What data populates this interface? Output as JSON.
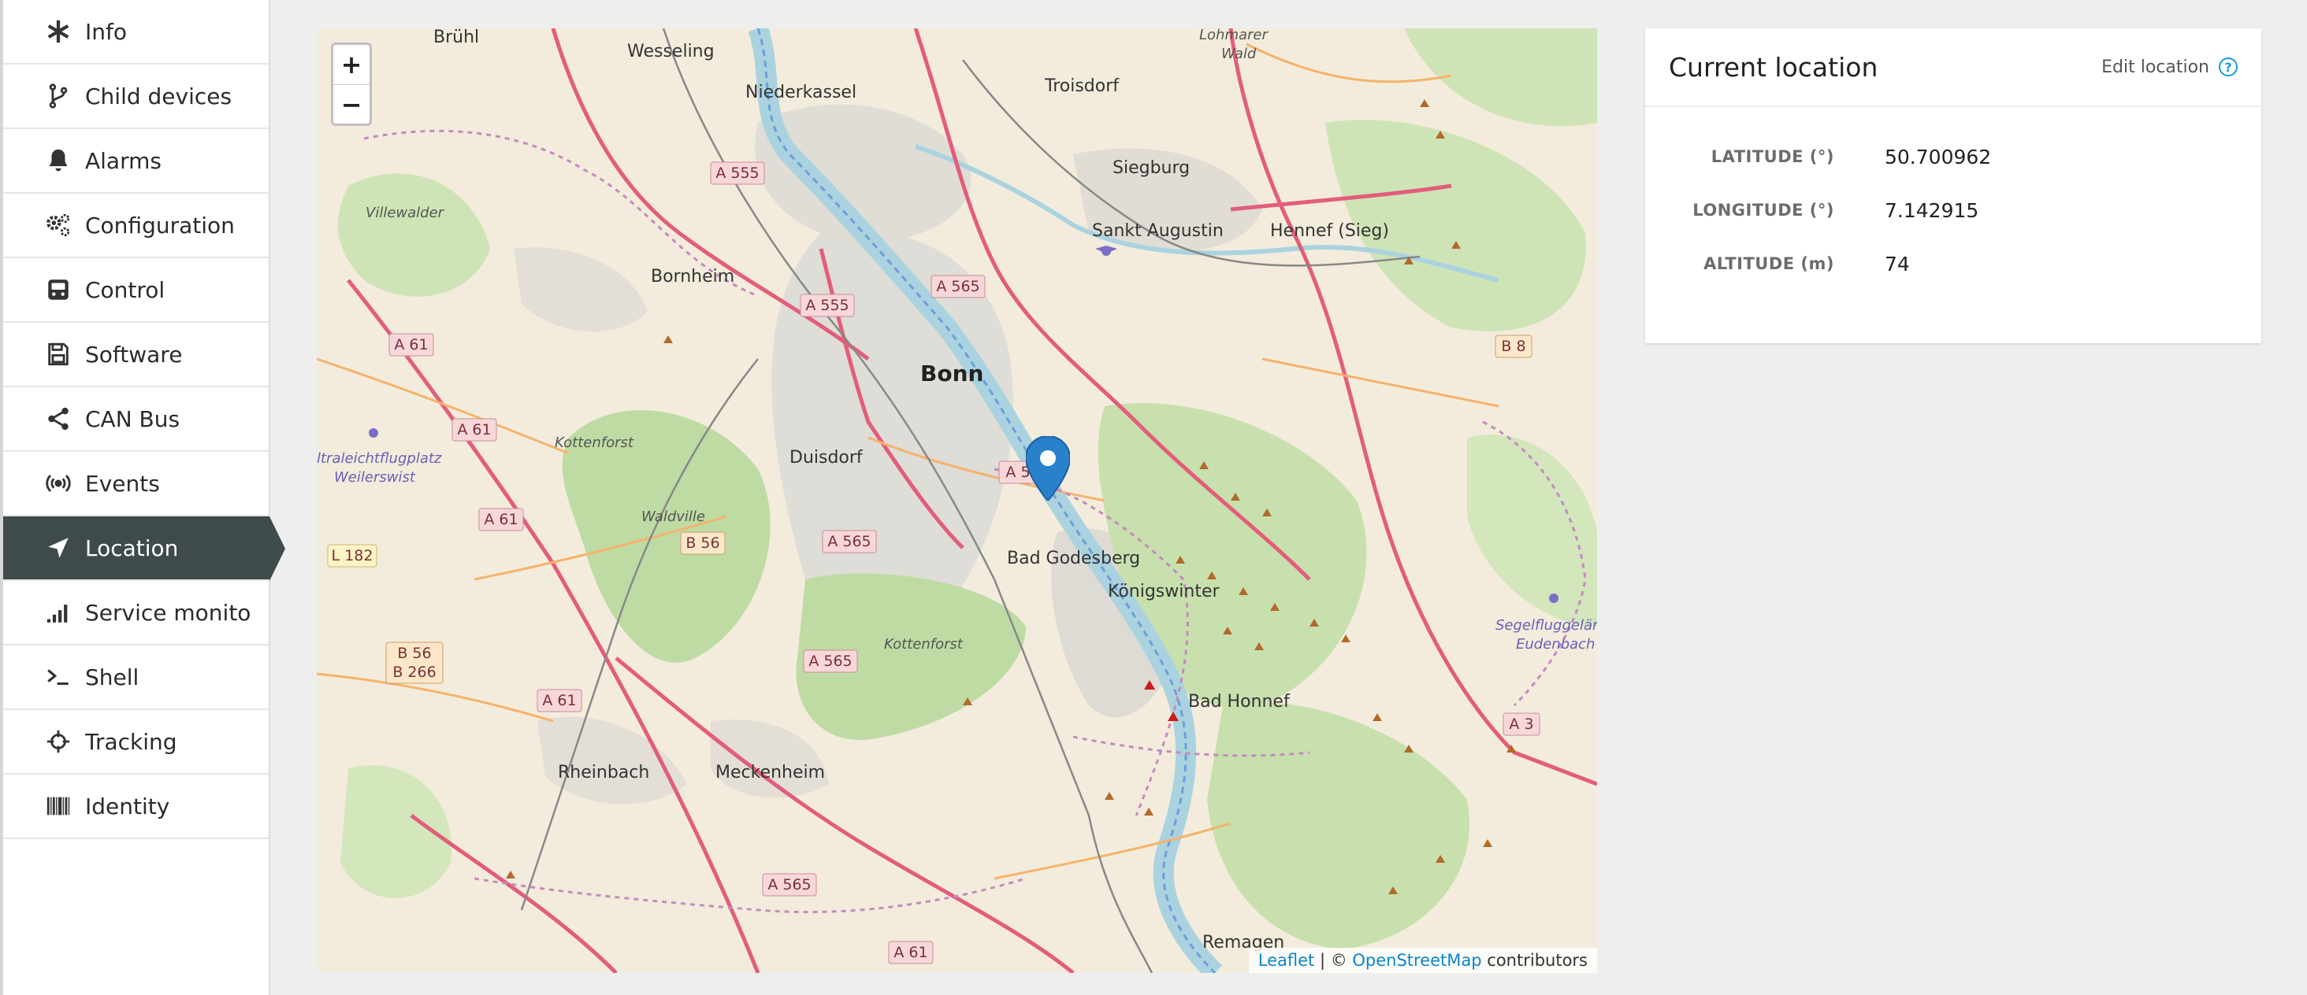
{
  "sidebar": {
    "items": [
      {
        "label": "Info",
        "icon": "asterisk-icon"
      },
      {
        "label": "Child devices",
        "icon": "branch-icon"
      },
      {
        "label": "Alarms",
        "icon": "bell-icon"
      },
      {
        "label": "Configuration",
        "icon": "gears-icon"
      },
      {
        "label": "Control",
        "icon": "control-panel-icon"
      },
      {
        "label": "Software",
        "icon": "floppy-disk-icon"
      },
      {
        "label": "CAN Bus",
        "icon": "share-nodes-icon"
      },
      {
        "label": "Events",
        "icon": "broadcast-icon"
      },
      {
        "label": "Location",
        "icon": "location-arrow-icon",
        "active": true
      },
      {
        "label": "Service monito...",
        "icon": "signal-bars-icon"
      },
      {
        "label": "Shell",
        "icon": "terminal-prompt-icon"
      },
      {
        "label": "Tracking",
        "icon": "crosshair-icon"
      },
      {
        "label": "Identity",
        "icon": "barcode-icon"
      }
    ]
  },
  "map": {
    "zoom_in": "+",
    "zoom_out": "−",
    "attribution": {
      "leaflet": "Leaflet",
      "separator": " | © ",
      "osm": "OpenStreetMap",
      "suffix": " contributors"
    },
    "places": {
      "bruhl": "Brühl",
      "wesseling": "Wesseling",
      "niederkassel": "Niederkassel",
      "troisdorf": "Troisdorf",
      "lohmarer_wald_1": "Lohmarer",
      "lohmarer_wald_2": "Wald",
      "siegburg": "Siegburg",
      "sankt_augustin": "Sankt Augustin",
      "hennef": "Hennef (Sieg)",
      "villewalder": "Villewalder",
      "bornheim": "Bornheim",
      "bonn": "Bonn",
      "kottenforst_1": "Kottenforst",
      "duisdorf": "Duisdorf",
      "waldville": "Waldville",
      "flugplatz_1": "ltraleichtflugplatz",
      "flugplatz_2": "Weilerswist",
      "bad_godesberg": "Bad Godesberg",
      "konigswinter": "Königswinter",
      "kottenforst_2": "Kottenforst",
      "segelflug_1": "Segelfluggelän",
      "segelflug_2": "Eudenbach",
      "bad_honnef": "Bad Honnef",
      "rheinbach": "Rheinbach",
      "meckenheim": "Meckenheim",
      "remagen": "Remagen"
    },
    "shields": {
      "a555_1": "A 555",
      "a555_2": "A 555",
      "a565_1": "A 565",
      "a61_1": "A 61",
      "a61_2": "A 61",
      "a61_3": "A 61",
      "b56": "B 56",
      "l182": "L 182",
      "a565_2": "A 565",
      "a565_3": "A 565",
      "b56_b266": "B 56",
      "b266": "B 266",
      "a61_4": "A 61",
      "a565_4": "A 565",
      "a61_5": "A 61",
      "a5x": "A 5",
      "b8": "B 8",
      "a3": "A 3"
    }
  },
  "location_panel": {
    "title": "Current location",
    "edit_label": "Edit location",
    "help_glyph": "?",
    "fields": [
      {
        "label": "LATITUDE (°)",
        "value": "50.700962"
      },
      {
        "label": "LONGITUDE (°)",
        "value": "7.142915"
      },
      {
        "label": "ALTITUDE (m)",
        "value": "74"
      }
    ]
  }
}
